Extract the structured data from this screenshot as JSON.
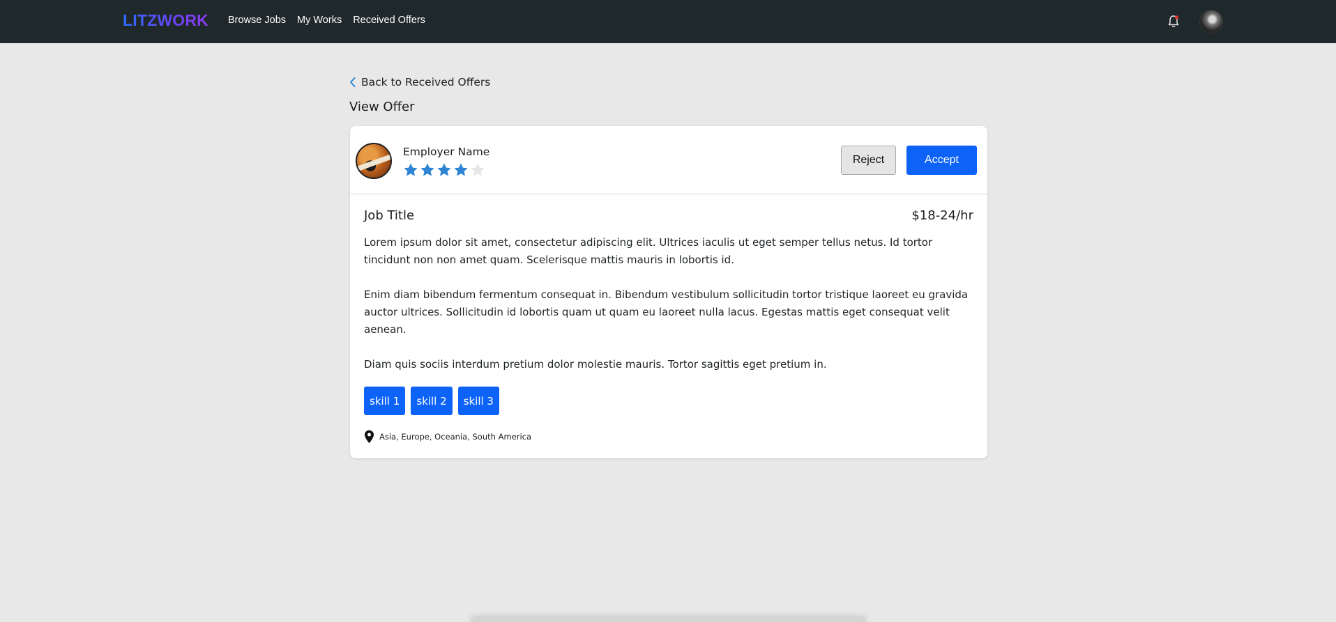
{
  "brand": {
    "name": "LITZWORK"
  },
  "nav": {
    "links": [
      {
        "label": "Browse Jobs"
      },
      {
        "label": "My Works"
      },
      {
        "label": "Received Offers"
      }
    ]
  },
  "page": {
    "back_label": "Back to Received Offers",
    "title": "View Offer"
  },
  "offer": {
    "employer_name": "Employer Name",
    "rating": 4,
    "rating_max": 5,
    "reject_label": "Reject",
    "accept_label": "Accept",
    "job_title": "Job Title",
    "rate": "$18-24/hr",
    "description": [
      "Lorem ipsum dolor sit amet, consectetur adipiscing elit. Ultrices iaculis ut eget semper tellus netus. Id tortor tincidunt non non amet quam. Scelerisque mattis mauris in lobortis id.",
      "Enim diam bibendum fermentum consequat in. Bibendum vestibulum sollicitudin tortor tristique laoreet eu gravida auctor ultrices. Sollicitudin id lobortis quam ut quam eu laoreet nulla lacus. Egestas mattis eget consequat velit aenean.",
      "Diam quis sociis interdum pretium dolor molestie mauris. Tortor sagittis eget pretium in."
    ],
    "skills": [
      "skill 1",
      "skill 2",
      "skill 3"
    ],
    "location": "Asia, Europe, Oceania, South America"
  },
  "icons": {
    "bell": "bell-icon",
    "back": "chevron-left-icon",
    "star": "star-icon",
    "location": "map-pin-icon"
  },
  "colors": {
    "navbar": "#1f282b",
    "accent": "#0d63f7",
    "star_filled": "#2f84d4",
    "star_empty": "#e6e6e6",
    "background": "#e8e8e8",
    "notification": "#e0332f"
  }
}
